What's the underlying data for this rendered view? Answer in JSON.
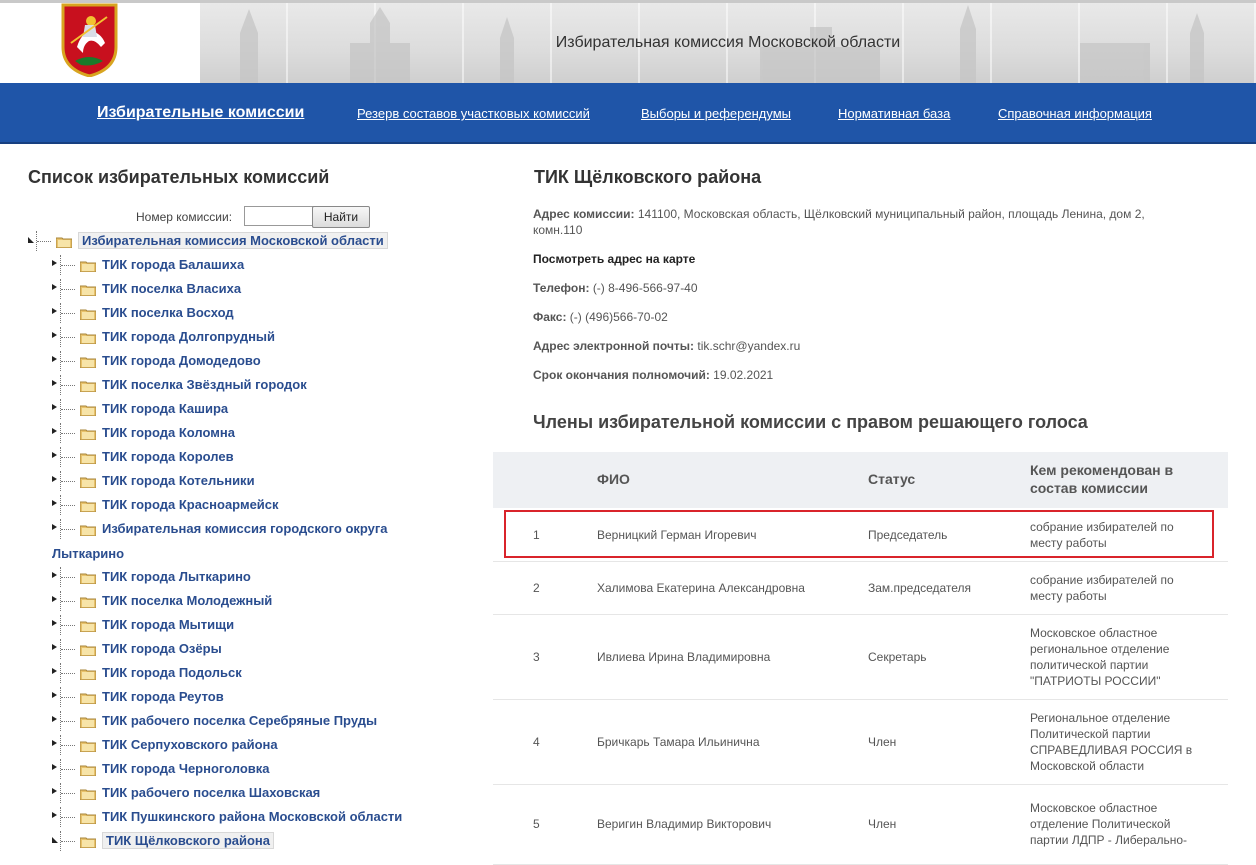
{
  "header": {
    "title": "Избирательная комиссия Московской области"
  },
  "nav": {
    "items": [
      "Избирательные комиссии",
      "Резерв составов участковых комиссий",
      "Выборы и референдумы",
      "Нормативная база",
      "Справочная информация"
    ]
  },
  "left": {
    "title": "Список избирательных комиссий",
    "search_label": "Номер комиссии:",
    "search_value": "",
    "search_button": "Найти",
    "tree": [
      "Избирательная комиссия Московской области",
      "ТИК города Балашиха",
      "ТИК поселка Власиха",
      "ТИК поселка Восход",
      "ТИК города Долгопрудный",
      "ТИК города Домодедово",
      "ТИК поселка Звёздный городок",
      "ТИК города Кашира",
      "ТИК города Коломна",
      "ТИК города Королев",
      "ТИК города Котельники",
      "ТИК города Красноармейск",
      "Избирательная комиссия городского округа",
      "ТИК города Лыткарино",
      "ТИК поселка Молодежный",
      "ТИК города Мытищи",
      "ТИК города Озёры",
      "ТИК города Подольск",
      "ТИК города Реутов",
      "ТИК рабочего поселка Серебряные Пруды",
      "ТИК Серпуховского района",
      "ТИК города Черноголовка",
      "ТИК рабочего поселка Шаховская",
      "ТИК Пушкинского района Московской области",
      "ТИК Щёлковского района"
    ],
    "tree_wrap_tail": "Лыткарино"
  },
  "right": {
    "title": "ТИК Щёлковского района",
    "address_label": "Адрес комиссии:",
    "address_line1": "141100, Московская область, Щёлковский муниципальный район, площадь Ленина, дом 2,",
    "address_line2": "комн.110",
    "map_link": "Посмотреть адрес на карте",
    "phone_label": "Телефон:",
    "phone": "(-) 8-496-566-97-40",
    "fax_label": "Факс:",
    "fax": "(-) (496)566-70-02",
    "email_label": "Адрес электронной почты:",
    "email": "tik.schr@yandex.ru",
    "term_label": "Срок окончания полномочий:",
    "term": "19.02.2021"
  },
  "members": {
    "title": "Члены избирательной комиссии с правом решающего голоса",
    "headers": {
      "fio": "ФИО",
      "status": "Статус",
      "rec_line1": "Кем рекомендован в",
      "rec_line2": "состав комиссии"
    },
    "rows": [
      {
        "num": "1",
        "fio": "Верницкий Герман Игоревич",
        "status": "Председатель",
        "rec": [
          "собрание избирателей по",
          "месту работы"
        ]
      },
      {
        "num": "2",
        "fio": "Халимова Екатерина Александровна",
        "status": "Зам.председателя",
        "rec": [
          "собрание избирателей по",
          "месту работы"
        ]
      },
      {
        "num": "3",
        "fio": "Ивлиева Ирина Владимировна",
        "status": "Секретарь",
        "rec": [
          "Московское областное",
          "региональное отделение",
          "политической партии",
          "\"ПАТРИОТЫ РОССИИ\""
        ]
      },
      {
        "num": "4",
        "fio": "Бричкарь Тамара Ильинична",
        "status": "Член",
        "rec": [
          "Региональное отделение",
          "Политической партии",
          "СПРАВЕДЛИВАЯ РОССИЯ в",
          "Московской области"
        ]
      },
      {
        "num": "5",
        "fio": "Веригин Владимир Викторович",
        "status": "Член",
        "rec": [
          "Московское областное",
          "отделение Политической",
          "партии ЛДПР - Либерально-"
        ]
      }
    ]
  }
}
